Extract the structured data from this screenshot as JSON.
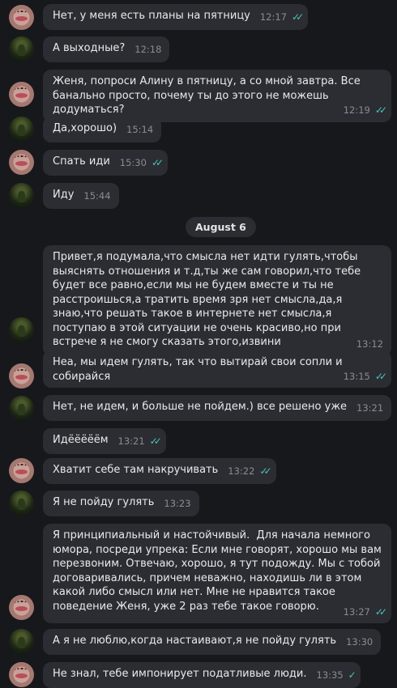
{
  "date_separator": "August 6",
  "tick_icon": "double-check-icon",
  "messages": [
    {
      "text": "Нет, у меня есть планы на пятницу",
      "time": "12:17",
      "read": true
    },
    {
      "text": "А выходные?",
      "time": "12:18",
      "read": false
    },
    {
      "text": "Женя, попроси Алину в пятницу, а со мной завтра. Все банально просто, почему ты до этого не можешь додуматься?",
      "time": "12:19",
      "read": true
    },
    {
      "text": "Да,хорошо)",
      "time": "15:14",
      "read": false
    },
    {
      "text": "Спать иди",
      "time": "15:30",
      "read": true
    },
    {
      "text": "Иду",
      "time": "15:44",
      "read": false
    },
    {
      "text": "Привет,я подумала,что смысла нет идти гулять,чтобы выяснять отношения и т.д,ты же сам говорил,что тебе будет все равно,если мы не будем вместе и ты не расстроишься,а тратить время зря нет смысла,да,я знаю,что решать такое в интернете нет смысла,я поступаю в этой ситуации не очень красиво,но при встрече я не смогу сказать этого,извини",
      "time": "13:12",
      "read": false
    },
    {
      "text": "Неа, мы идем гулять, так что вытирай свои сопли и собирайся",
      "time": "13:15",
      "read": true
    },
    {
      "text": "Нет, не идем, и больше не пойдем.) все решено уже",
      "time": "13:21",
      "read": false
    },
    {
      "text": "Идёёёёём",
      "time": "13:21",
      "read": true
    },
    {
      "text": "Хватит себе там накручивать",
      "time": "13:22",
      "read": true
    },
    {
      "text": "Я не пойду гулять",
      "time": "13:23",
      "read": false
    },
    {
      "text": "Я принципиальный и настойчивый.  Для начала немного юмора, посреди упрека: Если мне говорят, хорошо мы вам перезвоним. Отвечаю, хорошо, я тут подожду. Мы с тобой договаривались, причем неважно, находишь ли в этом какой либо смысл или нет. Мне не нравится такое поведение Женя, уже 2 раз тебе такое говорю.",
      "time": "13:27",
      "read": true
    },
    {
      "text": "А я не люблю,когда настаивают,я не пойду гулять",
      "time": "13:30",
      "read": false
    },
    {
      "text": "Не знал, тебе импонирует податливые люди.",
      "time": "13:35",
      "read": true
    }
  ]
}
